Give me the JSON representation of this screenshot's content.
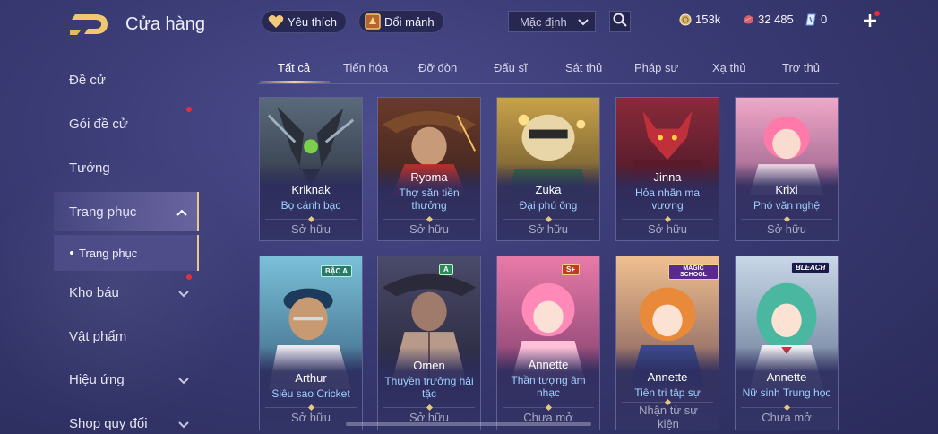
{
  "header": {
    "title": "Cửa hàng",
    "favorite_label": "Yêu thích",
    "exchange_label": "Đổi mảnh",
    "sort_value": "Mặc định",
    "currency": {
      "gold": "153k",
      "vouchers": "32 485",
      "quan_huy": "0"
    }
  },
  "sidebar": {
    "items": [
      {
        "label": "Đề cử"
      },
      {
        "label": "Gói đề cử"
      },
      {
        "label": "Tướng"
      },
      {
        "label": "Trang phục"
      },
      {
        "label": "Kho báu"
      },
      {
        "label": "Vật phẩm"
      },
      {
        "label": "Hiệu ứng"
      },
      {
        "label": "Shop quy đổi"
      }
    ],
    "sub_item": {
      "label": "Trang phục"
    }
  },
  "tabs": [
    {
      "label": "Tất cả"
    },
    {
      "label": "Tiến hóa"
    },
    {
      "label": "Đỡ đòn"
    },
    {
      "label": "Đấu sĩ"
    },
    {
      "label": "Sát thủ"
    },
    {
      "label": "Pháp sư"
    },
    {
      "label": "Xạ thủ"
    },
    {
      "label": "Trợ thủ"
    }
  ],
  "cards_row1": [
    {
      "hero": "Kriknak",
      "skin": "Bọ cánh bạc",
      "status": "Sở hữu"
    },
    {
      "hero": "Ryoma",
      "skin": "Thợ săn tiền thưởng",
      "status": "Sở hữu"
    },
    {
      "hero": "Zuka",
      "skin": "Đại phú ông",
      "status": "Sở hữu"
    },
    {
      "hero": "Jinna",
      "skin": "Hỏa nhãn ma vương",
      "status": "Sở hữu"
    },
    {
      "hero": "Krixi",
      "skin": "Phó văn nghệ",
      "status": "Sở hữu"
    }
  ],
  "cards_row2": [
    {
      "hero": "Arthur",
      "skin": "Siêu sao Cricket",
      "status": "Sở hữu",
      "badge": "BẬC A"
    },
    {
      "hero": "Omen",
      "skin": "Thuyền trưởng hải tặc",
      "status": "Sở hữu",
      "badge": "A"
    },
    {
      "hero": "Annette",
      "skin": "Thần tượng âm nhạc",
      "status": "Chưa mở",
      "badge": "S+"
    },
    {
      "hero": "Annette",
      "skin": "Tiên tri tập sự",
      "status": "Nhận từ sự kiện",
      "badge": "MAGIC SCHOOL"
    },
    {
      "hero": "Annette",
      "skin": "Nữ sinh Trung học",
      "status": "Chưa mở",
      "badge": "BLEACH"
    }
  ],
  "colors": {
    "accent_gold": "#f0d79a",
    "skin_name": "#9fd0ff",
    "notification": "#e0303a"
  }
}
